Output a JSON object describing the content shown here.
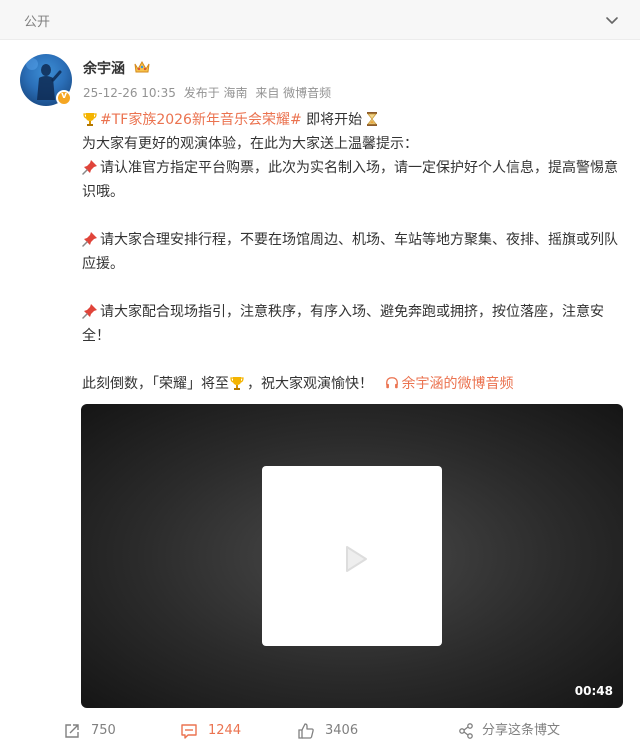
{
  "header": {
    "visibility": "公开",
    "expand_icon": "chevron-down-icon"
  },
  "author": {
    "name": "余宇涵",
    "badge_icon": "crown-icon",
    "verified_icon": "verified-v-icon",
    "verified_mark": "v",
    "timestamp": "25-12-26 10:35",
    "location": "发布于 海南",
    "source": "来自 微博音频"
  },
  "post": {
    "line1_hashtag": "#TF家族2026新年音乐会荣耀#",
    "line1_suffix": " 即将开始",
    "line2": "为大家有更好的观演体验，在此为大家送上温馨提示：",
    "tip1": "请认准官方指定平台购票，此次为实名制入场，请一定保护好个人信息，提高警惕意识哦。",
    "tip2": "请大家合理安排行程，不要在场馆周边、机场、车站等地方聚集、夜排、摇旗或列队应援。",
    "tip3": "请大家配合现场指引，注意秩序，有序入场、避免奔跑或拥挤，按位落座，注意安全！",
    "closing_prefix": "此刻倒数，「荣耀」将至",
    "closing_suffix": "，祝大家观演愉快！",
    "audio_link": "余宇涵的微博音频",
    "emoji_names": [
      "trophy-icon",
      "hourglass-icon",
      "pushpin-icon",
      "headphones-icon"
    ]
  },
  "video": {
    "duration": "00:48",
    "play_icon": "play-icon"
  },
  "actions": {
    "forward_count": "750",
    "comment_count": "1244",
    "like_count": "3406",
    "share_label": "分享这条博文"
  },
  "colors": {
    "accent": "#eb7350",
    "muted": "#939393",
    "text": "#333333",
    "badge": "#f5a623"
  }
}
